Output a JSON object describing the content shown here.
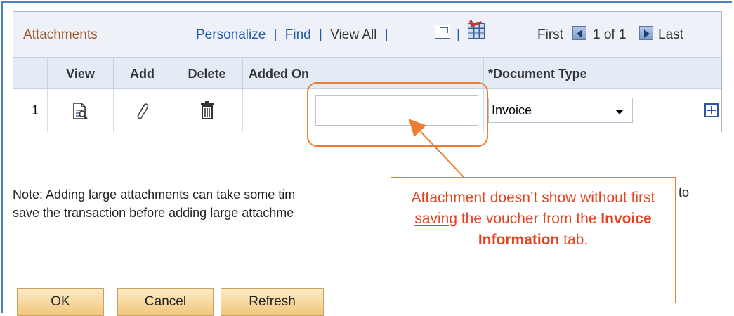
{
  "grid": {
    "title": "Attachments",
    "nav": {
      "personalize": "Personalize",
      "find": "Find",
      "view_all": "View All",
      "sep": "|"
    },
    "pager": {
      "first": "First",
      "range": "1 of 1",
      "last": "Last"
    },
    "columns": {
      "view": "View",
      "add": "Add",
      "delete": "Delete",
      "added_on": "Added On",
      "doc_type": "*Document Type"
    },
    "rows": [
      {
        "num": "1",
        "added_on": "",
        "doc_type": "Invoice"
      }
    ]
  },
  "note": {
    "line1": "Note: Adding large attachments can take some tim",
    "line1_tail": "to",
    "line2": "save the transaction before adding large attachme"
  },
  "callout": {
    "part1": "Attachment doesn’t show without first ",
    "underline": "saving",
    "part2": " the voucher from the ",
    "bold1": "Invoice Information",
    "part3": " tab."
  },
  "buttons": {
    "ok": "OK",
    "cancel": "Cancel",
    "refresh": "Refresh"
  },
  "colors": {
    "accent_orange": "#ee7d31",
    "callout_text": "#e4431f",
    "link_blue": "#1f5caa"
  }
}
